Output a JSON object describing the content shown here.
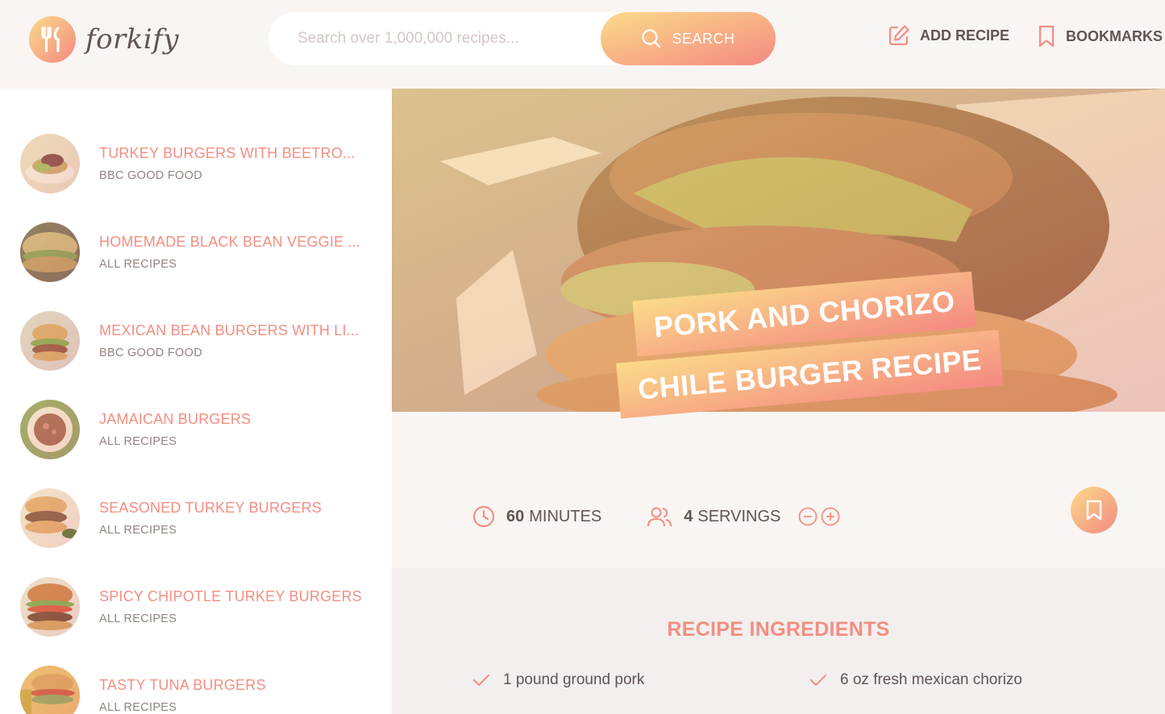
{
  "brand": {
    "name": "forkify"
  },
  "search": {
    "placeholder": "Search over 1,000,000 recipes...",
    "button_label": "SEARCH"
  },
  "nav": {
    "add_recipe": "ADD RECIPE",
    "bookmarks": "BOOKMARKS"
  },
  "results": [
    {
      "title": "TURKEY BURGERS WITH BEETRO...",
      "publisher": "BBC GOOD FOOD"
    },
    {
      "title": "HOMEMADE BLACK BEAN VEGGIE ...",
      "publisher": "ALL RECIPES"
    },
    {
      "title": "MEXICAN BEAN BURGERS WITH LI...",
      "publisher": "BBC GOOD FOOD"
    },
    {
      "title": "JAMAICAN BURGERS",
      "publisher": "ALL RECIPES"
    },
    {
      "title": "SEASONED TURKEY BURGERS",
      "publisher": "ALL RECIPES"
    },
    {
      "title": "SPICY CHIPOTLE TURKEY BURGERS",
      "publisher": "ALL RECIPES"
    },
    {
      "title": "TASTY TUNA BURGERS",
      "publisher": "ALL RECIPES"
    }
  ],
  "recipe": {
    "title_line1": "PORK AND CHORIZO",
    "title_line2": "CHILE BURGER RECIPE",
    "cooking_time": "60",
    "cooking_time_unit": "MINUTES",
    "servings": "4",
    "servings_unit": "SERVINGS"
  },
  "ingredients": {
    "heading": "RECIPE INGREDIENTS",
    "items": [
      "1 pound ground pork",
      "6 oz fresh mexican chorizo"
    ]
  },
  "colors": {
    "accent_start": "#fbdb89",
    "accent_end": "#f48982",
    "text": "#615551",
    "title_color": "#f38e82"
  },
  "icons": [
    "logo-fork-icon",
    "search-icon",
    "edit-icon",
    "bookmark-icon",
    "clock-icon",
    "users-icon",
    "minus-circle-icon",
    "plus-circle-icon",
    "check-icon"
  ]
}
